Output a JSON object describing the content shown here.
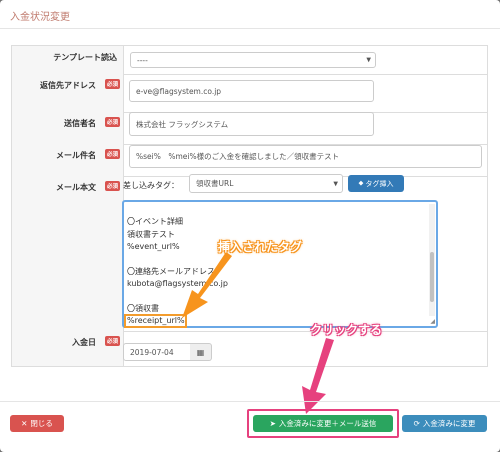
{
  "modal": {
    "title": "入金状況変更"
  },
  "form": {
    "template": {
      "label": "テンプレート読込",
      "value": "----"
    },
    "reply_address": {
      "label": "返信先アドレス",
      "required": "必須",
      "value": "e-ve@flagsystem.co.jp"
    },
    "sender_name": {
      "label": "送信者名",
      "required": "必須",
      "value": "株式会社 フラッグシステム"
    },
    "mail_subject": {
      "label": "メール件名",
      "required": "必須",
      "value": "%sei%　%mei%様のご入金を確認しました／領収書テスト"
    },
    "mail_body": {
      "label": "メール本文",
      "required": "必須",
      "insert_tag_label": "差し込みタグ：",
      "insert_tag_value": "領収書URL",
      "insert_tag_button": "タグ挿入",
      "lines": [
        "〇イベント詳細",
        "領収書テスト",
        "%event_url%",
        "",
        "〇連絡先メールアドレス",
        "kubota@flagsystem.co.jp",
        "",
        "〇領収書",
        "%receipt_url%"
      ]
    },
    "payment_date": {
      "label": "入金日",
      "required": "必須",
      "value": "2019-07-04"
    }
  },
  "annotations": {
    "inserted_tag": "挿入されたタグ",
    "click_here": "クリックする"
  },
  "footer": {
    "close": "閉じる",
    "change_and_send": "入金済みに変更＋メール送信",
    "change_only": "入金済みに変更"
  },
  "colors": {
    "danger": "#d9534f",
    "primary": "#337ab7",
    "success": "#2aa55f",
    "info": "#3c8dbc",
    "annotation_orange": "#f7941d",
    "annotation_pink": "#e6417e"
  }
}
